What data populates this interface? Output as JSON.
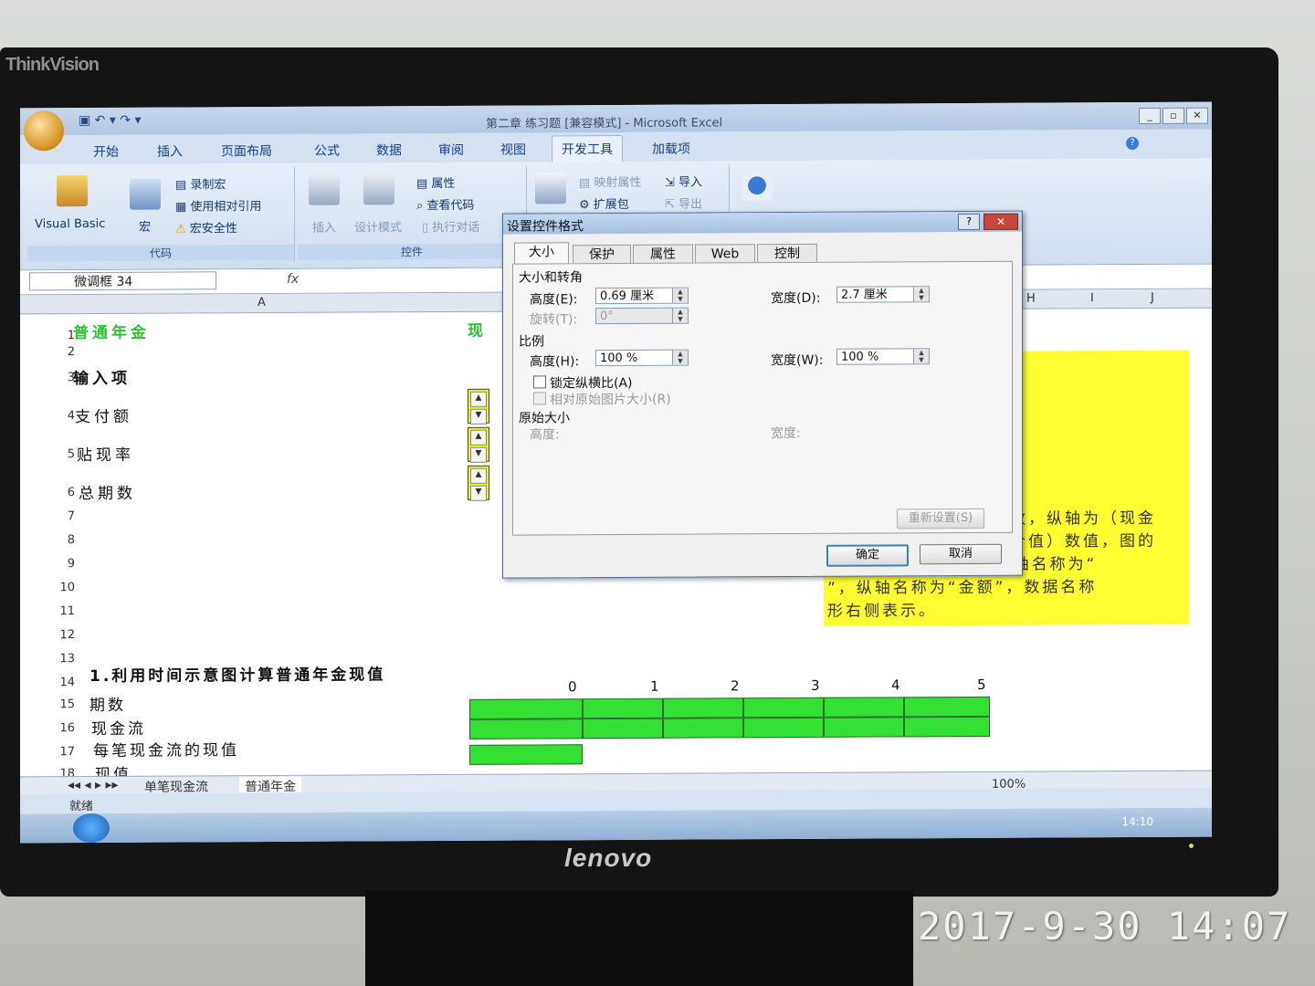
{
  "photo": {
    "monitor_brand_top": "ThinkVision",
    "monitor_brand_bottom": "lenovo",
    "timestamp": "2017-9-30 14:07"
  },
  "excel": {
    "window_title": "第二章 练习题 [兼容模式] - Microsoft Excel",
    "tabs": [
      "开始",
      "插入",
      "页面布局",
      "公式",
      "数据",
      "审阅",
      "视图",
      "开发工具",
      "加载项"
    ],
    "active_tab": "开发工具",
    "ribbon": {
      "code_group": {
        "label": "代码",
        "visual_basic": "Visual Basic",
        "macro": "宏",
        "record_macro": "录制宏",
        "relative_ref": "使用相对引用",
        "macro_security": "宏安全性"
      },
      "controls_group": {
        "label": "控件",
        "insert": "插入",
        "design_mode": "设计模式",
        "properties": "属性",
        "view_code": "查看代码",
        "run_dialog": "执行对话"
      },
      "xml_group": {
        "map_properties": "映射属性",
        "expansion_packs": "扩展包",
        "import": "导入",
        "export": "导出"
      }
    },
    "name_box": "微调框 34",
    "fx": "fx",
    "columns": [
      "A",
      "H",
      "I",
      "J"
    ],
    "rows": [
      "1",
      "2",
      "3",
      "4",
      "5",
      "6",
      "7",
      "8",
      "9",
      "10",
      "11",
      "12",
      "13",
      "14",
      "15",
      "16",
      "17",
      "18"
    ],
    "cells": {
      "a1": "普通年金",
      "b1_partial": "现",
      "a3": "输入项",
      "a4": "支付额",
      "a5": "贴现率",
      "a6": "总期数",
      "a14": "1.利用时间示意图计算普通年金现值",
      "a15": "期数",
      "a16": "现金流",
      "a17": "每笔现金流的现值",
      "a18": "现值"
    },
    "period_numbers": [
      "0",
      "1",
      "2",
      "3",
      "4",
      "5"
    ],
    "yellow_note_lines": [
      "数，纵轴为（现金",
      "价值）数值，图的",
      "为“普通年金现值”，横轴名称为“",
      "”，纵轴名称为“金额”，数据名称",
      "形右侧表示。"
    ],
    "sheet_tabs": [
      "单笔现金流",
      "普通年金"
    ],
    "status": {
      "ready": "就绪",
      "zoom": "100%"
    },
    "taskbar_clock": "14:10"
  },
  "dialog": {
    "title": "设置控件格式",
    "help": "?",
    "close": "✕",
    "tabs": [
      "大小",
      "保护",
      "属性",
      "Web",
      "控制"
    ],
    "active_tab": "大小",
    "section_size": "大小和转角",
    "height_label": "高度(E):",
    "height_value": "0.69 厘米",
    "width_label": "宽度(D):",
    "width_value": "2.7 厘米",
    "rotation_label": "旋转(T):",
    "rotation_value": "0°",
    "section_scale": "比例",
    "scale_height_label": "高度(H):",
    "scale_height_value": "100 %",
    "scale_width_label": "宽度(W):",
    "scale_width_value": "100 %",
    "lock_aspect": "锁定纵横比(A)",
    "relative_original": "相对原始图片大小(R)",
    "section_original": "原始大小",
    "orig_height": "高度:",
    "orig_width": "宽度:",
    "reset": "重新设置(S)",
    "ok": "确定",
    "cancel": "取消"
  }
}
